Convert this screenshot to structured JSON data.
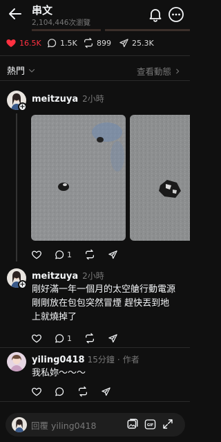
{
  "header": {
    "title": "串文",
    "views": "2,104,446次瀏覽"
  },
  "stats": {
    "likes": "16.5K",
    "replies": "1.5K",
    "reposts": "899",
    "shares": "25.3K"
  },
  "sort": {
    "label": "熱門",
    "activity_label": "查看動態"
  },
  "posts": [
    {
      "username": "meitzuya",
      "time": "2小時",
      "reply_count": "1"
    },
    {
      "username": "meitzuya",
      "time": "2小時",
      "text_lines": [
        "剛好滿一年一個月的太空艙行動電源",
        "剛剛放在包包突然冒煙 趕快丟到地",
        "上就燒掉了"
      ],
      "reply_count": "1"
    },
    {
      "username": "yiling0418",
      "time": "15分鐘",
      "badge": "作者",
      "separator": "·",
      "text": "我私妳〜〜〜"
    }
  ],
  "reply_bar": {
    "placeholder": "回覆 yiling0418"
  },
  "colors": {
    "background": "#101010",
    "accent_like": "#ff3040",
    "muted_text": "#777777"
  }
}
